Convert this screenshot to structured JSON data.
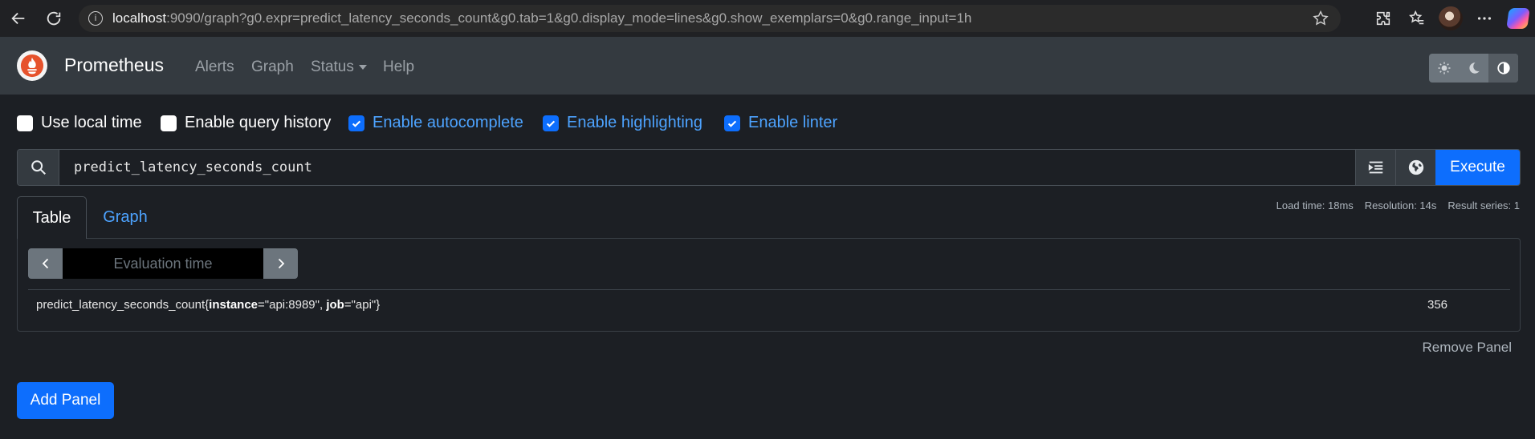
{
  "browser": {
    "url_host": "localhost",
    "url_rest": ":9090/graph?g0.expr=predict_latency_seconds_count&g0.tab=1&g0.display_mode=lines&g0.show_exemplars=0&g0.range_input=1h"
  },
  "navbar": {
    "brand": "Prometheus",
    "links": {
      "alerts": "Alerts",
      "graph": "Graph",
      "status": "Status",
      "help": "Help"
    }
  },
  "options": {
    "local_time": {
      "label": "Use local time",
      "checked": false
    },
    "query_history": {
      "label": "Enable query history",
      "checked": false
    },
    "autocomplete": {
      "label": "Enable autocomplete",
      "checked": true
    },
    "highlighting": {
      "label": "Enable highlighting",
      "checked": true
    },
    "linter": {
      "label": "Enable linter",
      "checked": true
    }
  },
  "query": {
    "expression": "predict_latency_seconds_count",
    "execute_label": "Execute"
  },
  "stats": {
    "load_time": "Load time: 18ms",
    "resolution": "Resolution: 14s",
    "result_series": "Result series: 1"
  },
  "tabs": {
    "table": "Table",
    "graph": "Graph"
  },
  "panel": {
    "eval_placeholder": "Evaluation time",
    "result": {
      "metric": "predict_latency_seconds_count",
      "open_brace": "{",
      "label1_key": "instance",
      "label1_value": "=\"api:8989\", ",
      "label2_key": "job",
      "label2_value": "=\"api\"",
      "close_brace": "}",
      "value": "356"
    },
    "remove_label": "Remove Panel"
  },
  "add_panel_label": "Add Panel",
  "colors": {
    "accent": "#0d6efd",
    "link": "#4da3ff",
    "navbar": "#343a40",
    "background": "#1c1f24"
  }
}
